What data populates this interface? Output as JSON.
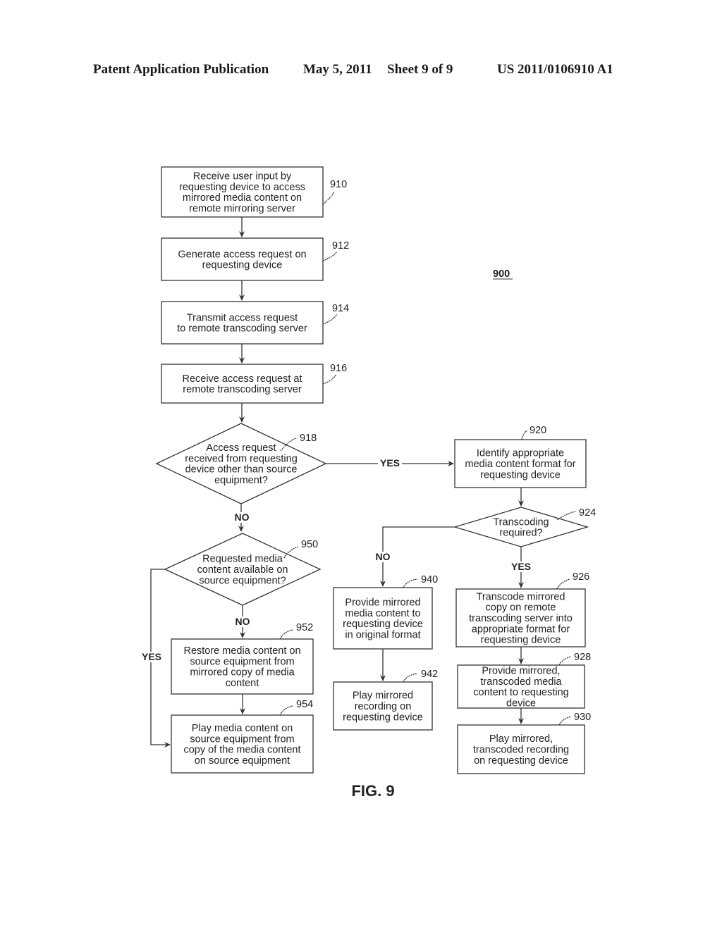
{
  "header": {
    "publication": "Patent Application Publication",
    "date": "May 5, 2011",
    "sheet": "Sheet 9 of 9",
    "number": "US 2011/0106910 A1"
  },
  "diagram": {
    "ref": "900",
    "figure": "FIG. 9",
    "nodes": {
      "n910": {
        "ref": "910",
        "type": "process",
        "lines": [
          "Receive user input by",
          "requesting device to access",
          "mirrored media content on",
          "remote mirroring server"
        ]
      },
      "n912": {
        "ref": "912",
        "type": "process",
        "lines": [
          "Generate access request on",
          "requesting device"
        ]
      },
      "n914": {
        "ref": "914",
        "type": "process",
        "lines": [
          "Transmit access request",
          "to remote transcoding server"
        ]
      },
      "n916": {
        "ref": "916",
        "type": "process",
        "lines": [
          "Receive access request at",
          "remote transcoding server"
        ]
      },
      "n918": {
        "ref": "918",
        "type": "decision",
        "lines": [
          "Access request",
          "received from requesting",
          "device other than source",
          "equipment?"
        ]
      },
      "n920": {
        "ref": "920",
        "type": "process",
        "lines": [
          "Identify appropriate",
          "media content format for",
          "requesting device"
        ]
      },
      "n924": {
        "ref": "924",
        "type": "decision",
        "lines": [
          "Transcoding",
          "required?"
        ]
      },
      "n926": {
        "ref": "926",
        "type": "process",
        "lines": [
          "Transcode mirrored",
          "copy on remote",
          "transcoding server into",
          "appropriate format for",
          "requesting device"
        ]
      },
      "n928": {
        "ref": "928",
        "type": "process",
        "lines": [
          "Provide mirrored,",
          "transcoded media",
          "content to requesting",
          "device"
        ]
      },
      "n930": {
        "ref": "930",
        "type": "process",
        "lines": [
          "Play mirrored,",
          "transcoded recording",
          "on requesting device"
        ]
      },
      "n940": {
        "ref": "940",
        "type": "process",
        "lines": [
          "Provide mirrored",
          "media content to",
          "requesting device",
          "in original format"
        ]
      },
      "n942": {
        "ref": "942",
        "type": "process",
        "lines": [
          "Play mirrored",
          "recording on",
          "requesting device"
        ]
      },
      "n950": {
        "ref": "950",
        "type": "decision",
        "lines": [
          "Requested media",
          "content available on",
          "source equipment?"
        ]
      },
      "n952": {
        "ref": "952",
        "type": "process",
        "lines": [
          "Restore media content on",
          "source equipment from",
          "mirrored copy of media",
          "content"
        ]
      },
      "n954": {
        "ref": "954",
        "type": "process",
        "lines": [
          "Play media content on",
          "source equipment from",
          "copy of the media content",
          "on source equipment"
        ]
      }
    },
    "edges": [
      {
        "from": "910",
        "to": "912",
        "label": ""
      },
      {
        "from": "912",
        "to": "914",
        "label": ""
      },
      {
        "from": "914",
        "to": "916",
        "label": ""
      },
      {
        "from": "916",
        "to": "918",
        "label": ""
      },
      {
        "from": "918",
        "to": "920",
        "label": "YES"
      },
      {
        "from": "918",
        "to": "950",
        "label": "NO"
      },
      {
        "from": "920",
        "to": "924",
        "label": ""
      },
      {
        "from": "924",
        "to": "926",
        "label": "YES"
      },
      {
        "from": "924",
        "to": "940",
        "label": "NO"
      },
      {
        "from": "926",
        "to": "928",
        "label": ""
      },
      {
        "from": "928",
        "to": "930",
        "label": ""
      },
      {
        "from": "940",
        "to": "942",
        "label": ""
      },
      {
        "from": "950",
        "to": "952",
        "label": "NO"
      },
      {
        "from": "950",
        "to": "954",
        "label": "YES"
      },
      {
        "from": "952",
        "to": "954",
        "label": ""
      }
    ]
  }
}
